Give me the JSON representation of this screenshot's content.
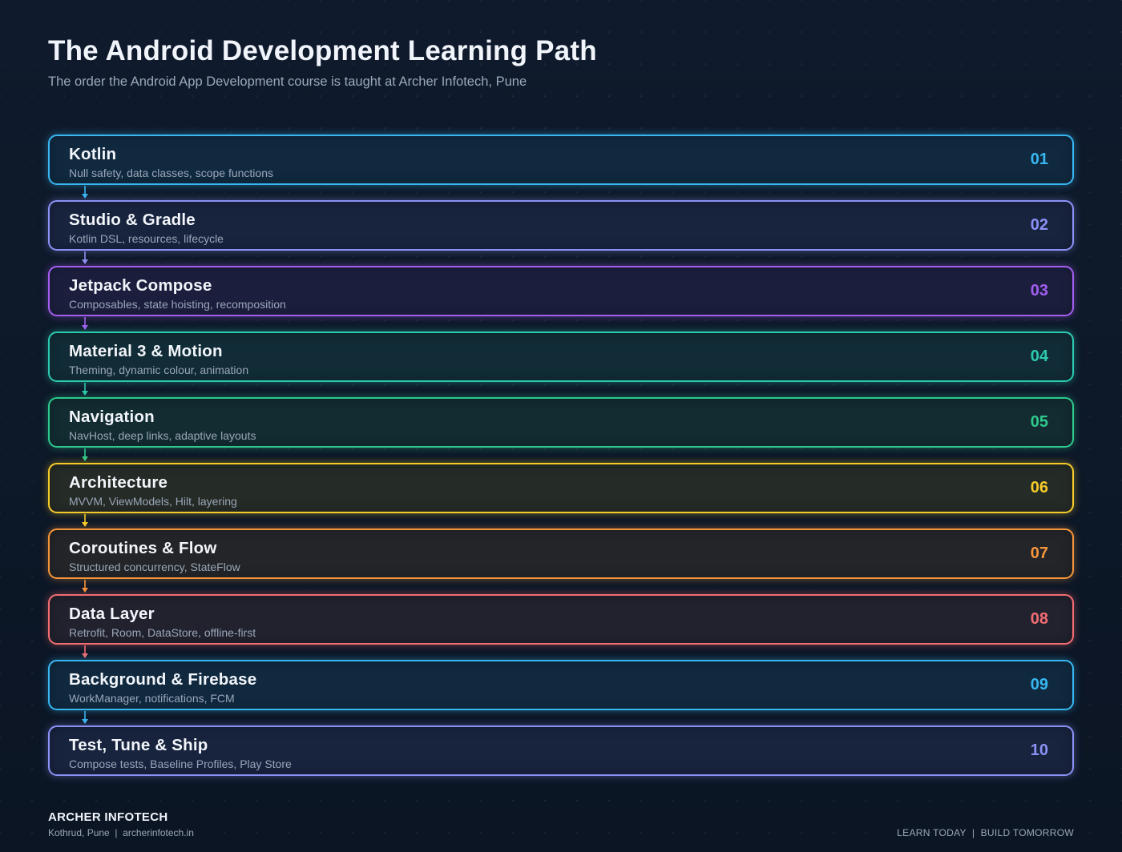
{
  "header": {
    "title": "The Android Development Learning Path",
    "subtitle": "The order the Android App Development course is taught at Archer Infotech, Pune"
  },
  "steps": [
    {
      "number": "01",
      "name": "Kotlin",
      "desc": "Null safety, data classes, scope functions",
      "color": "#38b6f1",
      "bg": "#10293f",
      "glow": "rgba(56,182,241,0.45)"
    },
    {
      "number": "02",
      "name": "Studio & Gradle",
      "desc": "Kotlin DSL, resources, lifecycle",
      "color": "#8b91f5",
      "bg": "#18233e",
      "glow": "rgba(139,145,245,0.45)"
    },
    {
      "number": "03",
      "name": "Jetpack Compose",
      "desc": "Composables, state hoisting, recomposition",
      "color": "#a35ef0",
      "bg": "#1b1f3d",
      "glow": "rgba(163,94,240,0.45)"
    },
    {
      "number": "04",
      "name": "Material 3 & Motion",
      "desc": "Theming, dynamic colour, animation",
      "color": "#2cc9b0",
      "bg": "#112c36",
      "glow": "rgba(44,201,176,0.45)"
    },
    {
      "number": "05",
      "name": "Navigation",
      "desc": "NavHost, deep links, adaptive layouts",
      "color": "#2ec98d",
      "bg": "#122c31",
      "glow": "rgba(46,201,141,0.45)"
    },
    {
      "number": "06",
      "name": "Architecture",
      "desc": "MVVM, ViewModels, Hilt, layering",
      "color": "#f5cb2a",
      "bg": "#252b26",
      "glow": "rgba(245,203,42,0.45)"
    },
    {
      "number": "07",
      "name": "Coroutines & Flow",
      "desc": "Structured concurrency, StateFlow",
      "color": "#f4953b",
      "bg": "#232528",
      "glow": "rgba(244,149,59,0.45)"
    },
    {
      "number": "08",
      "name": "Data Layer",
      "desc": "Retrofit, Room, DataStore, offline-first",
      "color": "#f26d72",
      "bg": "#22222f",
      "glow": "rgba(242,109,114,0.45)"
    },
    {
      "number": "09",
      "name": "Background & Firebase",
      "desc": "WorkManager, notifications, FCM",
      "color": "#38b6f1",
      "bg": "#10293f",
      "glow": "rgba(56,182,241,0.45)"
    },
    {
      "number": "10",
      "name": "Test, Tune & Ship",
      "desc": "Compose tests, Baseline Profiles, Play Store",
      "color": "#8b91f5",
      "bg": "#18233e",
      "glow": "rgba(139,145,245,0.45)"
    }
  ],
  "footer": {
    "brand": "ARCHER INFOTECH",
    "location": "Kothrud, Pune  |  archerinfotech.in",
    "tagline": "LEARN TODAY  |  BUILD TOMORROW"
  }
}
